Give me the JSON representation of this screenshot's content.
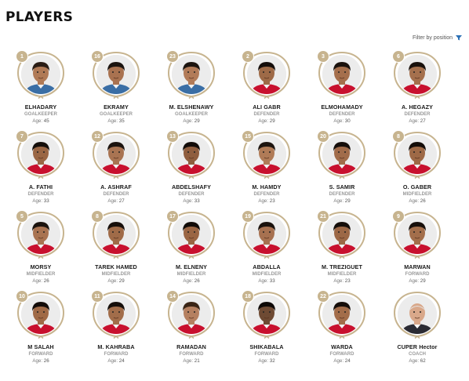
{
  "header": {
    "title": "PLAYERS",
    "filter_label": "Filter by position"
  },
  "colors": {
    "frame_gold": "#c7b48f",
    "badge_gold": "#c7b48f",
    "shirt_red": "#c8102e",
    "shirt_gk": "#3a6ea5",
    "background": "#ffffff"
  },
  "age_prefix": "Age:",
  "players": [
    {
      "number": "1",
      "name": "ELHADARY",
      "position": "GOALKEEPER",
      "age": "45",
      "shirt": "gk",
      "skin": "#b07a56",
      "hair": "#2a1d15"
    },
    {
      "number": "16",
      "name": "EKRAMY",
      "position": "GOALKEEPER",
      "age": "35",
      "shirt": "gk",
      "skin": "#a97250",
      "hair": "#1b1410"
    },
    {
      "number": "23",
      "name": "M. ELSHENAWY",
      "position": "GOALKEEPER",
      "age": "29",
      "shirt": "gk",
      "skin": "#b27b58",
      "hair": "#1d1510"
    },
    {
      "number": "2",
      "name": "ALI GABR",
      "position": "DEFENDER",
      "age": "29",
      "shirt": "red",
      "skin": "#9e6a47",
      "hair": "#140e0b"
    },
    {
      "number": "3",
      "name": "ELMOHAMADY",
      "position": "DEFENDER",
      "age": "30",
      "shirt": "red",
      "skin": "#a56f4c",
      "hair": "#1a120d"
    },
    {
      "number": "6",
      "name": "A. HEGAZY",
      "position": "DEFENDER",
      "age": "27",
      "shirt": "red",
      "skin": "#a5704d",
      "hair": "#1a120d"
    },
    {
      "number": "7",
      "name": "A. FATHI",
      "position": "DEFENDER",
      "age": "33",
      "shirt": "red",
      "skin": "#9a6644",
      "hair": "#150f0b"
    },
    {
      "number": "12",
      "name": "A. ASHRAF",
      "position": "DEFENDER",
      "age": "27",
      "shirt": "red",
      "skin": "#a97452",
      "hair": "#1c140f"
    },
    {
      "number": "13",
      "name": "ABDELSHAFY",
      "position": "DEFENDER",
      "age": "33",
      "shirt": "red",
      "skin": "#8f5d3e",
      "hair": "#120c09"
    },
    {
      "number": "15",
      "name": "M. HAMDY",
      "position": "DEFENDER",
      "age": "23",
      "shirt": "red",
      "skin": "#b07b57",
      "hair": "#1d1510"
    },
    {
      "number": "20",
      "name": "S. SAMIR",
      "position": "DEFENDER",
      "age": "29",
      "shirt": "red",
      "skin": "#a16c4a",
      "hair": "#160f0b"
    },
    {
      "number": "8",
      "name": "O. GABER",
      "position": "MIDFIELDER",
      "age": "26",
      "shirt": "red",
      "skin": "#9e6946",
      "hair": "#140d09"
    },
    {
      "number": "5",
      "name": "MORSY",
      "position": "MIDFIELDER",
      "age": "26",
      "shirt": "red",
      "skin": "#a97351",
      "hair": "#1b130e"
    },
    {
      "number": "8",
      "name": "TAREK HAMED",
      "position": "MIDFIELDER",
      "age": "29",
      "shirt": "red",
      "skin": "#a06b48",
      "hair": "#170f0b"
    },
    {
      "number": "17",
      "name": "M. ELNENY",
      "position": "MIDFIELDER",
      "age": "26",
      "shirt": "red",
      "skin": "#9a6543",
      "hair": "#110b08"
    },
    {
      "number": "19",
      "name": "ABDALLA",
      "position": "MIDFIELDER",
      "age": "33",
      "shirt": "red",
      "skin": "#a77150",
      "hair": "#1a120d"
    },
    {
      "number": "21",
      "name": "M. TREZIGUET",
      "position": "MIDFIELDER",
      "age": "23",
      "shirt": "red",
      "skin": "#9c6846",
      "hair": "#150e0a"
    },
    {
      "number": "9",
      "name": "MARWAN",
      "position": "FORWARD",
      "age": "29",
      "shirt": "red",
      "skin": "#a36e4b",
      "hair": "#170f0b"
    },
    {
      "number": "10",
      "name": "M SALAH",
      "position": "FORWARD",
      "age": "26",
      "shirt": "red",
      "skin": "#a06a47",
      "hair": "#130c09"
    },
    {
      "number": "11",
      "name": "M. KAHRABA",
      "position": "FORWARD",
      "age": "24",
      "shirt": "red",
      "skin": "#a26d4a",
      "hair": "#160f0b"
    },
    {
      "number": "14",
      "name": "RAMADAN",
      "position": "FORWARD",
      "age": "21",
      "shirt": "red",
      "skin": "#b58060",
      "hair": "#3a2516"
    },
    {
      "number": "18",
      "name": "SHIKABALA",
      "position": "FORWARD",
      "age": "32",
      "shirt": "red",
      "skin": "#6e4a33",
      "hair": "#0d0907"
    },
    {
      "number": "22",
      "name": "WARDA",
      "position": "FORWARD",
      "age": "24",
      "shirt": "red",
      "skin": "#a36d4a",
      "hair": "#160e0a"
    },
    {
      "number": "",
      "name": "CUPER Hector",
      "position": "COACH",
      "age": "62",
      "shirt": "coach",
      "skin": "#d9a88a",
      "hair": "#e6e6e6"
    }
  ]
}
